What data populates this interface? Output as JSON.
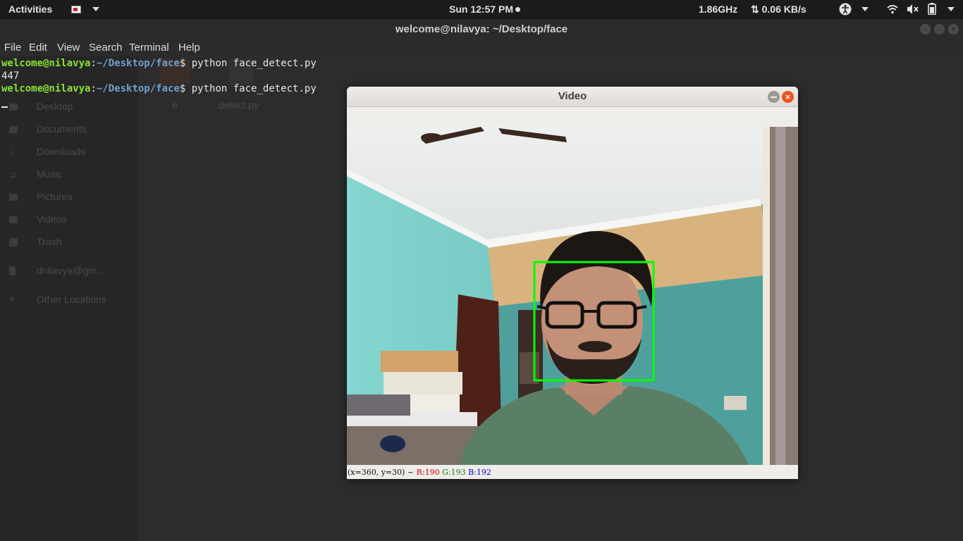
{
  "topbar": {
    "activities": "Activities",
    "clock": "Sun 12:57 PM",
    "cpu": "1.86GHz",
    "net": "⇅ 0.06 KB/s"
  },
  "terminal": {
    "title": "welcome@nilavya: ~/Desktop/face",
    "menu": [
      "File",
      "Edit",
      "View",
      "Search",
      "Terminal",
      "Help"
    ],
    "lines": [
      {
        "user": "welcome@nilavya",
        "sep": ":",
        "path": "~/Desktop/face",
        "prompt": "$ ",
        "cmd": "python face_detect.py"
      },
      {
        "output": "447"
      },
      {
        "user": "welcome@nilavya",
        "sep": ":",
        "path": "~/Desktop/face",
        "prompt": "$ ",
        "cmd": "python face_detect.py"
      }
    ]
  },
  "file_manager": {
    "sidebar": [
      "Desktop",
      "Documents",
      "Downloads",
      "Music",
      "Pictures",
      "Videos",
      "Trash",
      "dnilavya@gm...",
      "Other Locations"
    ],
    "files": [
      "e",
      "detect.py"
    ]
  },
  "video_window": {
    "title": "Video",
    "status": {
      "coords": "(x=360, y=30) ~ ",
      "r": "R:190",
      "g": "G:193",
      "b": "B:192"
    }
  },
  "colors": {
    "prompt_user": "#8ae234",
    "prompt_path": "#729fcf",
    "close_button": "#e95420",
    "detection_box": "#00ff00"
  }
}
